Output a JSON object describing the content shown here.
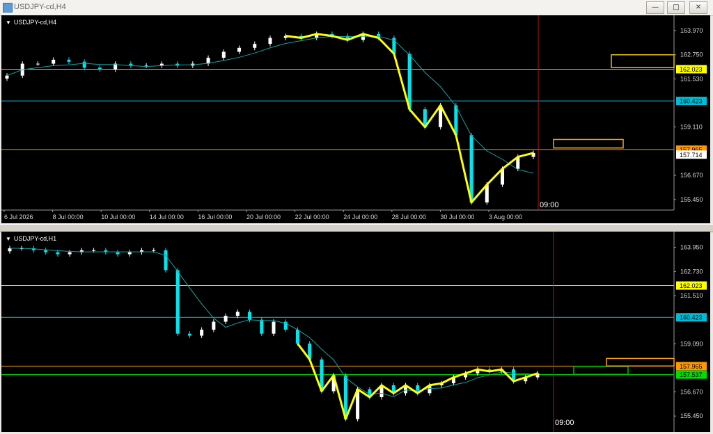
{
  "window": {
    "title": "USDJPY-cd,H4",
    "buttons": [
      "—",
      "□",
      "✕"
    ]
  },
  "colors": {
    "background": "#000000",
    "candle_bull": "#ffffff",
    "candle_bear": "#00e5ee",
    "ma": "#19a3a3",
    "zigzag": "#ffff00",
    "level_yellow": "#e6d200",
    "level_cyan": "#19b5c8",
    "level_orange": "#ff9f1a",
    "level_green": "#00e000",
    "now_line": "#b01818"
  },
  "charts": {
    "h4": {
      "title": "USDJPY-cd,H4",
      "price_labels": [
        "163.970",
        "162.750",
        "161.530",
        "159.110",
        "156.670",
        "155.450"
      ],
      "badges": [
        {
          "text": "162.023",
          "kind": "yellow"
        },
        {
          "text": "160.423",
          "kind": "cyan"
        },
        {
          "text": "157.965",
          "kind": "orange"
        },
        {
          "text": "157.714",
          "kind": "white"
        }
      ],
      "time_labels": [
        "6 Jul 2026",
        "8 Jul 00:00",
        "10 Jul 00:00",
        "14 Jul 00:00",
        "16 Jul 00:00",
        "20 Jul 00:00",
        "22 Jul 00:00",
        "24 Jul 00:00",
        "28 Jul 00:00",
        "30 Jul 00:00",
        "3 Aug 00:00"
      ],
      "time_marker": "09:00"
    },
    "h1": {
      "title": "USDJPY-cd,H1",
      "price_labels": [
        "163.950",
        "162.730",
        "161.510",
        "159.090",
        "156.670",
        "155.450"
      ],
      "badges": [
        {
          "text": "162.023",
          "kind": "yellow"
        },
        {
          "text": "160.423",
          "kind": "cyan"
        },
        {
          "text": "157.965",
          "kind": "orange"
        },
        {
          "text": "157.537",
          "kind": "green"
        }
      ],
      "time_marker": "09:00"
    }
  },
  "chart_data": [
    {
      "type": "line",
      "title": "USDJPY-cd,H4",
      "xlabel": "",
      "ylabel": "",
      "ylim": [
        155.2,
        164.6
      ],
      "x_ticks": [
        "6 Jul 2026",
        "8 Jul 00:00",
        "10 Jul 00:00",
        "14 Jul 00:00",
        "16 Jul 00:00",
        "20 Jul 00:00",
        "22 Jul 00:00",
        "24 Jul 00:00",
        "28 Jul 00:00",
        "30 Jul 00:00",
        "3 Aug 00:00"
      ],
      "y_ticks": [
        163.97,
        162.75,
        161.53,
        159.11,
        156.67,
        155.45
      ],
      "horizontal_levels": [
        162.023,
        160.423,
        157.965,
        157.714
      ],
      "series": [
        {
          "name": "",
          "values": [
            161.7,
            162.3,
            162.3,
            162.5,
            162.4,
            162.1,
            162.0,
            162.3,
            162.2,
            162.2,
            162.3,
            162.2,
            162.3,
            162.6,
            162.9,
            163.1,
            163.3,
            163.6,
            163.7,
            163.6,
            163.8,
            163.7,
            163.5,
            163.8,
            163.6,
            162.8,
            160.0,
            159.1,
            160.2,
            158.7,
            155.3,
            156.2,
            157.0,
            157.6,
            157.8
          ]
        }
      ],
      "grid": false
    },
    {
      "type": "line",
      "title": "USDJPY-cd,H1",
      "xlabel": "",
      "ylabel": "",
      "ylim": [
        155.0,
        164.6
      ],
      "y_ticks": [
        163.95,
        162.73,
        161.51,
        159.09,
        156.67,
        155.45
      ],
      "horizontal_levels": [
        162.023,
        160.423,
        157.965,
        157.537
      ],
      "series": [
        {
          "name": "",
          "values": [
            163.9,
            163.9,
            163.8,
            163.7,
            163.6,
            163.7,
            163.8,
            163.8,
            163.7,
            163.6,
            163.7,
            163.8,
            163.8,
            162.8,
            159.6,
            159.5,
            159.8,
            160.2,
            160.5,
            160.7,
            160.3,
            159.6,
            160.2,
            159.8,
            159.1,
            158.3,
            156.7,
            157.5,
            155.3,
            156.8,
            156.4,
            157.0,
            156.6,
            157.0,
            156.6,
            157.0,
            157.1,
            157.4,
            157.6,
            157.8,
            157.7,
            157.8,
            157.2,
            157.4,
            157.6
          ]
        }
      ],
      "grid": false
    }
  ]
}
